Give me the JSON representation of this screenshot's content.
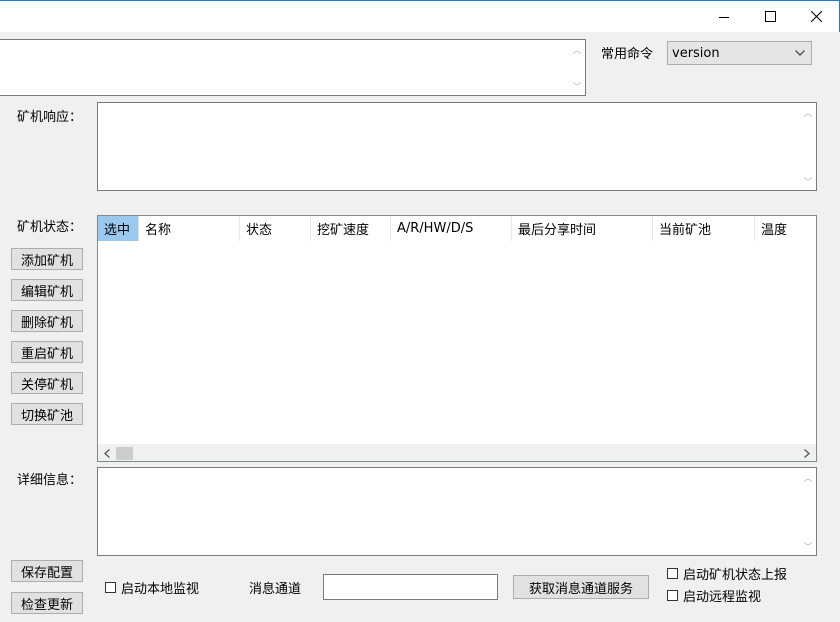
{
  "titlebar": {
    "minimize_icon": "minimize-icon",
    "maximize_icon": "maximize-icon",
    "close_icon": "close-icon"
  },
  "command": {
    "common_label": "常用命令",
    "selected": "version"
  },
  "response": {
    "label": "矿机响应："
  },
  "status": {
    "label": "矿机状态：",
    "columns": [
      "选中",
      "名称",
      "状态",
      "挖矿速度",
      "A/R/HW/D/S",
      "最后分享时间",
      "当前矿池",
      "温度"
    ]
  },
  "actions": {
    "add": "添加矿机",
    "edit": "编辑矿机",
    "delete": "删除矿机",
    "restart": "重启矿机",
    "shutdown": "关停矿机",
    "switch_pool": "切换矿池"
  },
  "detail": {
    "label": "详细信息："
  },
  "footer": {
    "save_config": "保存配置",
    "check_update": "检查更新",
    "local_monitor": "启动本地监视",
    "channel_label": "消息通道",
    "channel_value": "",
    "get_channel_service": "获取消息通道服务",
    "report_status": "启动矿机状态上报",
    "remote_monitor": "启动远程监视"
  }
}
